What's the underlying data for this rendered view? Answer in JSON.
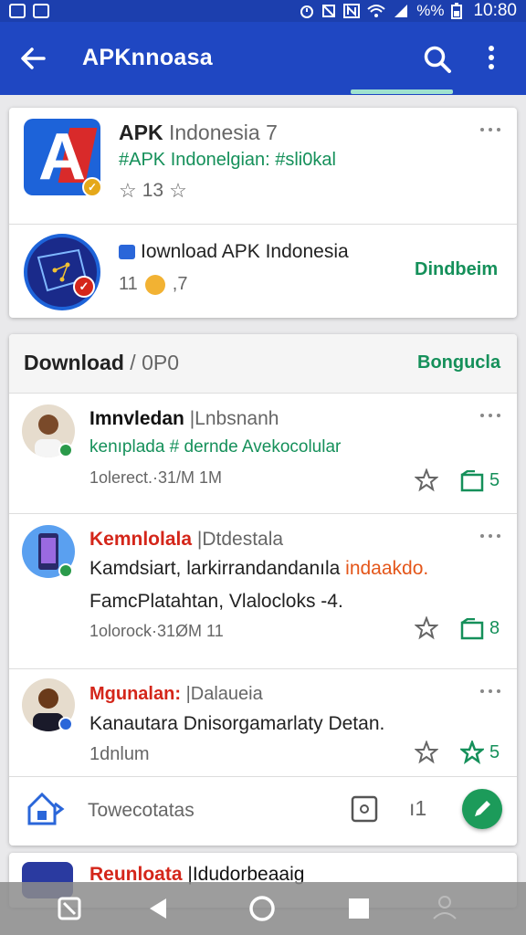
{
  "status_bar": {
    "time": "10:80",
    "battery_text": "%%",
    "left_icons": [
      "photo-icon",
      "image-icon"
    ],
    "right_icons": [
      "alarm-icon",
      "mute-icon",
      "nfc-icon",
      "wifi-icon",
      "signal-icon",
      "battery-icon"
    ]
  },
  "app_bar": {
    "title": "APKnnoasa",
    "icons": [
      "back-arrow-icon",
      "search-icon",
      "more-vert-icon"
    ],
    "accent_color": "#1f47c2",
    "indicator_color": "#9fe2cf"
  },
  "app_card": {
    "name": "APK",
    "name_suffix": "Indonesia 7",
    "subtitle": "#APK  Indonelgian: #sli0kal",
    "rating_text": "13",
    "icons": [
      "app-logo-icon",
      "star-icon",
      "more-horiz-icon"
    ]
  },
  "promo_row": {
    "title": "Iownload APK Indonesia",
    "meta": "11",
    "meta_tail": ",7",
    "action": "Dindbeim",
    "icons": [
      "globe-logo-icon",
      "verified-icon",
      "coin-icon"
    ]
  },
  "section": {
    "title": "Download",
    "slash": "/",
    "count": "0P0",
    "action": "Bongucla"
  },
  "posts": [
    {
      "author": "Imnvledan",
      "author_extra": "|Lnbsnanh",
      "line1": "kenıplada # dernde Avekocolular",
      "line2": "",
      "meta": "1olerect.·31/M 1M",
      "count": "5",
      "author_color": "#111111",
      "badge_color": "#2a9a4a",
      "avatar_icon": "person-avatar-icon"
    },
    {
      "author": "Kemnlolala",
      "author_extra": "|Dtdestala",
      "line1_a": "Kamdsiart, larkirrandandanıla",
      "line1_b": "indaakdo.",
      "line2": "FamcPlatahtan, Vlalocloks -4.",
      "meta": "1olorock·31ØM 11",
      "count": "8",
      "author_color": "#d4261a",
      "badge_color": "#2a9a4a",
      "avatar_icon": "phone-avatar-icon"
    },
    {
      "author": "Mgunalan:",
      "author_extra": "|Dalaueia",
      "line1": "Kanautara Dnisorgamarlaty Detan.",
      "line2": "",
      "meta": "1dnlum",
      "count": "5",
      "author_color": "#d4261a",
      "badge_color": "#2a66d9",
      "avatar_icon": "person-avatar-icon"
    }
  ],
  "footer_row": {
    "label": "Towecotatas",
    "count_glyph": "ı1",
    "icons": [
      "home-bag-icon",
      "camera-box-icon",
      "edit-icon"
    ]
  },
  "partial_post": {
    "author": "Reunloata",
    "author_extra": "|Idudorbeaaig",
    "author_color": "#d4261a"
  },
  "nav_bar": {
    "icons": [
      "recent-note-icon",
      "back-triangle-icon",
      "home-circle-icon",
      "overview-square-icon",
      "profile-icon"
    ]
  }
}
